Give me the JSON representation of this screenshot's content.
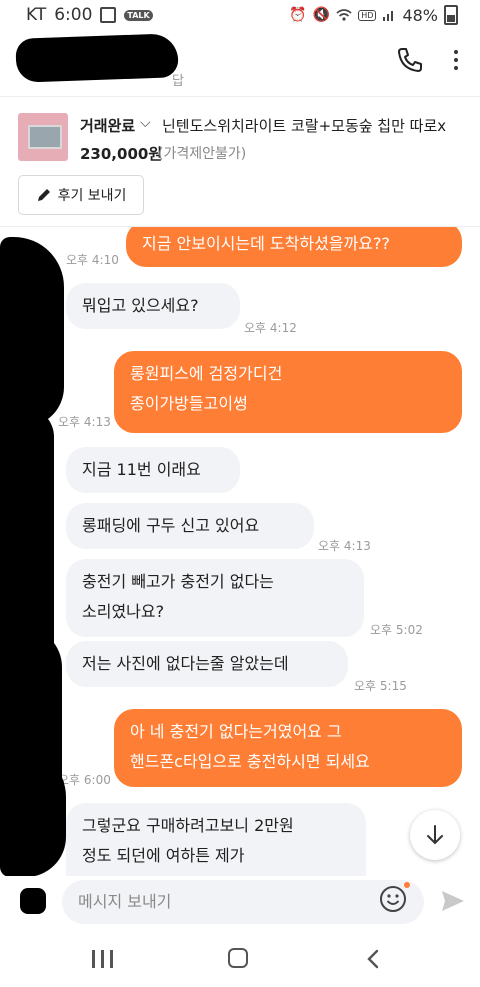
{
  "status_bar": {
    "carrier": "KT",
    "time": "6:00",
    "talk_badge": "TALK",
    "hd_badge": "HD",
    "battery": "48%"
  },
  "header": {
    "subtitle_fragment": "답",
    "icons": [
      "phone-icon",
      "more-vert-icon"
    ]
  },
  "product": {
    "status": "거래완료",
    "title": "닌텐도스위치라이트 코랄+모동숲 칩만 따로x",
    "price": "230,000원",
    "price_note": "(가격제안불가)"
  },
  "review_button": {
    "label": "후기 보내기"
  },
  "messages": [
    {
      "side": "out",
      "lines": [
        "지금 안보이시는데 도착하셨을까요??"
      ],
      "time": "오후 4:10"
    },
    {
      "side": "in",
      "lines": [
        "뭐입고 있으세요?"
      ],
      "time": "오후 4:12"
    },
    {
      "side": "out",
      "lines": [
        "롱원피스에 검정가디건",
        "종이가방들고이썽"
      ],
      "time": "오후 4:13"
    },
    {
      "side": "in",
      "lines": [
        "지금 11번 이래요"
      ],
      "time": ""
    },
    {
      "side": "in",
      "lines": [
        "롱패딩에 구두 신고 있어요"
      ],
      "time": "오후 4:13"
    },
    {
      "side": "in",
      "lines": [
        "충전기 빼고가 충전기 없다는",
        "소리였나요?"
      ],
      "time": "오후 5:02"
    },
    {
      "side": "in",
      "lines": [
        "저는 사진에 없다는줄 알았는데"
      ],
      "time": "오후 5:15"
    },
    {
      "side": "out",
      "lines": [
        "아 네 충전기 없다는거였어요 그",
        "핸드폰c타입으로 충전하시면 되세요"
      ],
      "time": "오후 6:00"
    },
    {
      "side": "in",
      "lines": [
        "그렇군요 구매하려고보니 2만원",
        "정도 되던에 여하튼 제가"
      ],
      "time": ""
    }
  ],
  "input": {
    "placeholder": "메시지 보내기"
  },
  "colors": {
    "accent": "#ff7e36",
    "incoming_bubble": "#f2f3f6"
  }
}
